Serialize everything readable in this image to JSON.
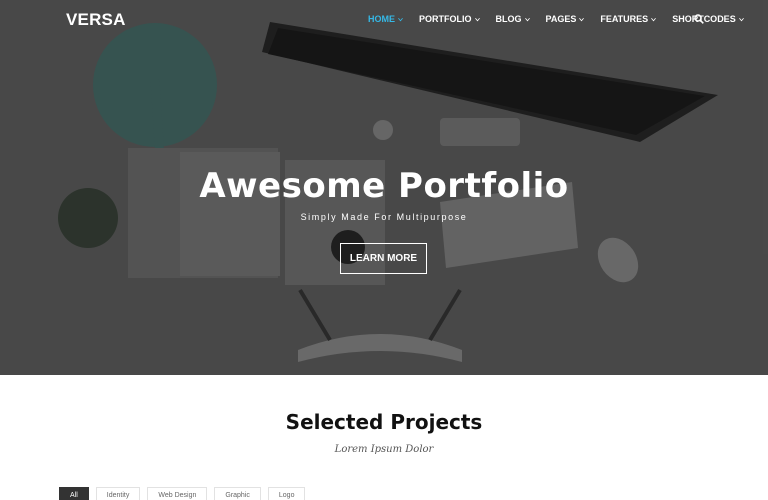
{
  "brand": {
    "logo": "VERSA",
    "accent": "#35b8e6"
  },
  "nav": {
    "items": [
      {
        "label": "HOME",
        "active": true
      },
      {
        "label": "PORTFOLIO",
        "active": false
      },
      {
        "label": "BLOG",
        "active": false
      },
      {
        "label": "PAGES",
        "active": false
      },
      {
        "label": "FEATURES",
        "active": false
      },
      {
        "label": "SHORTCODES",
        "active": false
      }
    ],
    "search_icon": "search-icon"
  },
  "hero": {
    "title": "Awesome Portfolio",
    "subtitle": "Simply Made For Multipurpose",
    "button_label": "LEARN MORE"
  },
  "section": {
    "title": "Selected Projects",
    "subtitle": "Lorem Ipsum Dolor"
  },
  "filters": [
    {
      "label": "All",
      "active": true
    },
    {
      "label": "Identity",
      "active": false
    },
    {
      "label": "Web Design",
      "active": false
    },
    {
      "label": "Graphic",
      "active": false
    },
    {
      "label": "Logo",
      "active": false
    }
  ]
}
